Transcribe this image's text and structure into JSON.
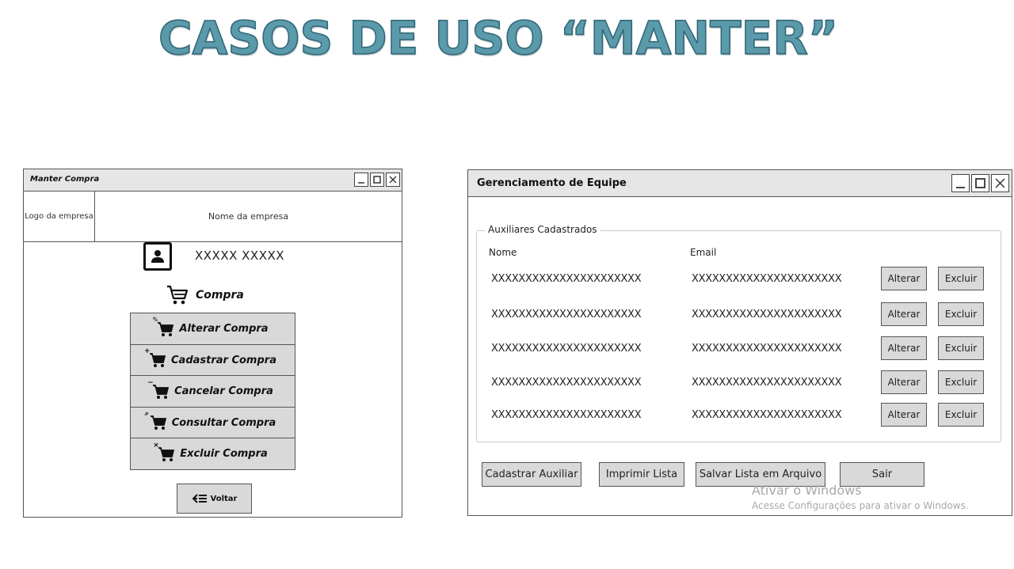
{
  "slide": {
    "title": "CASOS DE USO “MANTER”"
  },
  "left_window": {
    "title": "Manter Compra",
    "logo_text": "Logo da empresa",
    "company_text": "Nome da empresa",
    "user_name": "XXXXX XXXXX",
    "section_label": "Compra",
    "menu": [
      {
        "label": "Alterar Compra",
        "mark": "✎"
      },
      {
        "label": "Cadastrar Compra",
        "mark": "+"
      },
      {
        "label": "Cancelar Compra",
        "mark": "−"
      },
      {
        "label": "Consultar Compra",
        "mark": "⌕"
      },
      {
        "label": "Excluir Compra",
        "mark": "×"
      }
    ],
    "back_label": "Voltar"
  },
  "right_window": {
    "title": "Gerenciamento de Equipe",
    "group_label": "Auxiliares Cadastrados",
    "columns": {
      "name": "Nome",
      "email": "Email"
    },
    "rows": [
      {
        "name": "XXXXXXXXXXXXXXXXXXXXXX",
        "email": "XXXXXXXXXXXXXXXXXXXXXX",
        "edit": "Alterar",
        "delete": "Excluir"
      },
      {
        "name": "XXXXXXXXXXXXXXXXXXXXXX",
        "email": "XXXXXXXXXXXXXXXXXXXXXX",
        "edit": "Alterar",
        "delete": "Excluir"
      },
      {
        "name": "XXXXXXXXXXXXXXXXXXXXXX",
        "email": "XXXXXXXXXXXXXXXXXXXXXX",
        "edit": "Alterar",
        "delete": "Excluir"
      },
      {
        "name": "XXXXXXXXXXXXXXXXXXXXXX",
        "email": "XXXXXXXXXXXXXXXXXXXXXX",
        "edit": "Alterar",
        "delete": "Excluir"
      },
      {
        "name": "XXXXXXXXXXXXXXXXXXXXXX",
        "email": "XXXXXXXXXXXXXXXXXXXXXX",
        "edit": "Alterar",
        "delete": "Excluir"
      }
    ],
    "footer": {
      "add": "Cadastrar Auxiliar",
      "print": "Imprimir Lista",
      "save": "Salvar Lista em Arquivo",
      "exit": "Sair"
    }
  },
  "watermark": {
    "line1": "Ativar o Windows",
    "line2": "Acesse Configurações para ativar o Windows."
  }
}
